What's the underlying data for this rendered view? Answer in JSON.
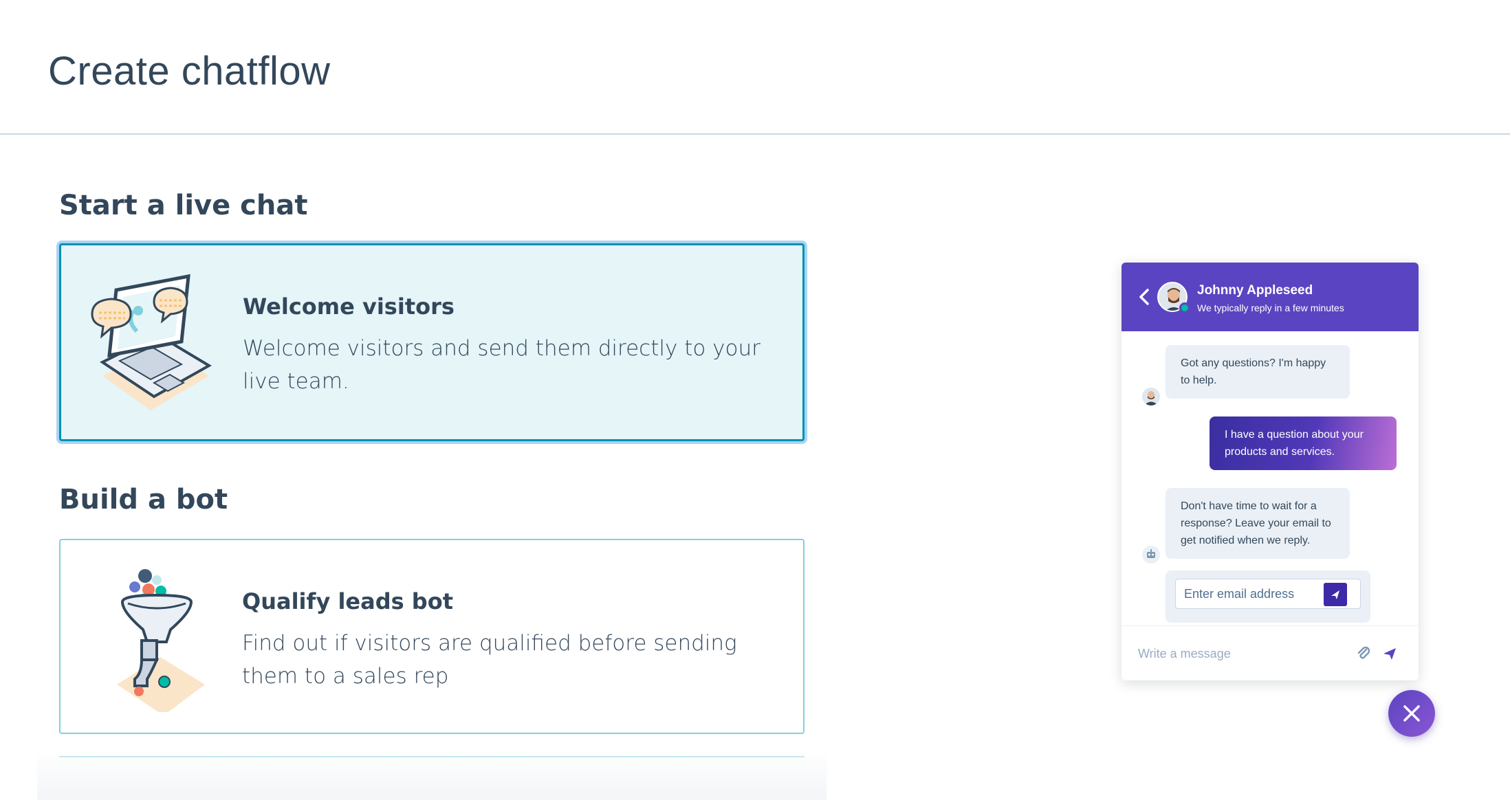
{
  "page": {
    "title": "Create chatflow"
  },
  "sections": {
    "live_chat": {
      "heading": "Start a live chat",
      "card": {
        "title": "Welcome visitors",
        "description": "Welcome visitors and send them directly to your live team.",
        "selected": true
      }
    },
    "bot": {
      "heading": "Build a bot",
      "card": {
        "title": "Qualify leads bot",
        "description": "Find out if visitors are qualified before sending them to a sales rep"
      }
    }
  },
  "chat_preview": {
    "agent_name": "Johnny Appleseed",
    "agent_status": "We typically reply in a few minutes",
    "messages": [
      {
        "from": "agent",
        "text": "Got any questions? I'm happy to help."
      },
      {
        "from": "visitor",
        "text": "I have a question about your products and services."
      },
      {
        "from": "bot",
        "text": "Don't have time to wait for a response? Leave your email to get notified when we reply."
      }
    ],
    "email_placeholder": "Enter email address",
    "composer_placeholder": "Write a message",
    "header_color": "#5b44c1",
    "online_color": "#00bda5"
  },
  "icons": {
    "back": "chevron-left-icon",
    "attach": "paperclip-icon",
    "send": "paper-plane-icon",
    "close": "close-icon"
  }
}
